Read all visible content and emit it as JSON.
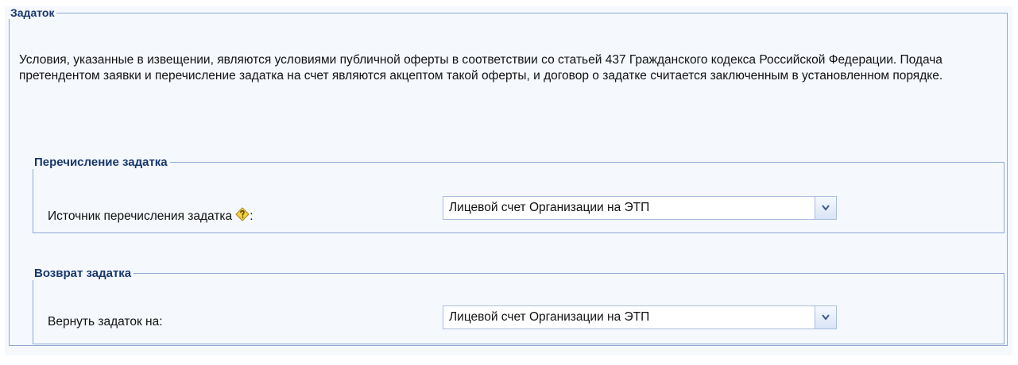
{
  "deposit": {
    "title": "Задаток",
    "intro": "Условия, указанные в извещении, являются условиями публичной оферты в соответствии со статьей 437 Гражданского кодекса Российской Федерации. Подача претендентом заявки и перечисление задатка на счет являются акцептом такой оферты, и договор о задатке считается заключенным в установленном порядке."
  },
  "transfer": {
    "title": "Перечисление задатка",
    "source_label": "Источник перечисления задатка",
    "source_colon": ":",
    "source_value": "Лицевой счет Организации на ЭТП",
    "hint_icon": "hint-icon"
  },
  "refund": {
    "title": "Возврат задатка",
    "return_label": "Вернуть задаток на:",
    "return_value": "Лицевой счет Организации на ЭТП"
  },
  "colors": {
    "legend": "#17376b",
    "border": "#8fa9d3",
    "background": "#f5f8fd"
  }
}
